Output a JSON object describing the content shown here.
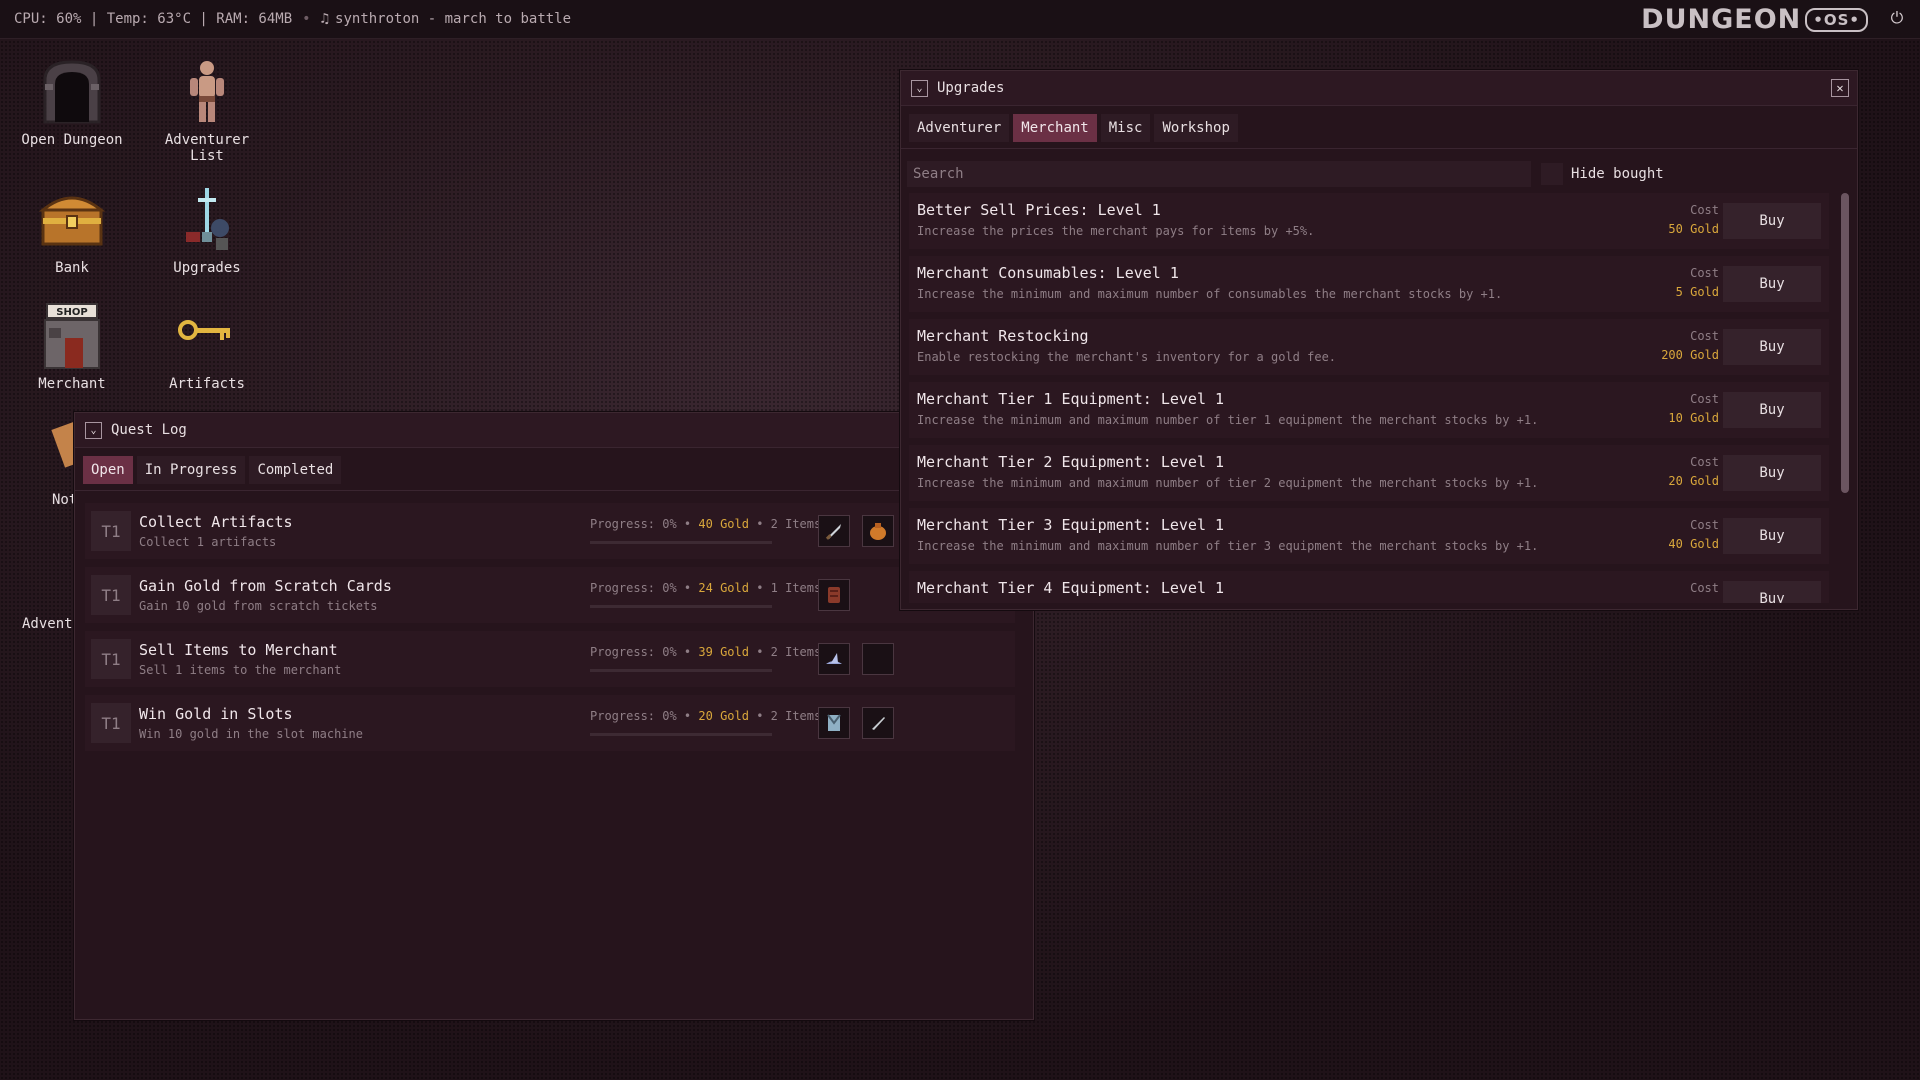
{
  "topbar": {
    "stats": "CPU: 60% | Temp: 63°C | RAM: 64MB",
    "track": "synthroton - march to battle",
    "music_icon": "music-note-icon",
    "logo_text": "DUNGEON",
    "logo_badge": "OS",
    "power_icon": "power-icon"
  },
  "desktop": {
    "icons": [
      {
        "label": "Open Dungeon",
        "icon": "dungeon-door-icon"
      },
      {
        "label": "Adventurer List",
        "icon": "adventurer-figure-icon"
      },
      {
        "label": "Bank",
        "icon": "treasure-chest-icon"
      },
      {
        "label": "Upgrades",
        "icon": "upgrades-icon"
      },
      {
        "label": "Merchant",
        "icon": "shop-icon"
      },
      {
        "label": "Artifacts",
        "icon": "key-icon"
      },
      {
        "label": "Not",
        "icon": "notes-scroll-icon"
      },
      {
        "label": "Adventu",
        "icon": "lightbulb-icon"
      }
    ]
  },
  "quest_log": {
    "title": "Quest Log",
    "tabs": [
      "Open",
      "In Progress",
      "Completed"
    ],
    "active_tab": "Open",
    "quests": [
      {
        "tier": "T1",
        "title": "Collect Artifacts",
        "desc": "Collect 1 artifacts",
        "progress": "Progress: 0%",
        "gold": "40 Gold",
        "items": "2 Items",
        "progress_value": 0
      },
      {
        "tier": "T1",
        "title": "Gain Gold from Scratch Cards",
        "desc": "Gain 10 gold from scratch tickets",
        "progress": "Progress: 0%",
        "gold": "24 Gold",
        "items": "1 Items",
        "progress_value": 0
      },
      {
        "tier": "T1",
        "title": "Sell Items to Merchant",
        "desc": "Sell 1 items to the merchant",
        "progress": "Progress: 0%",
        "gold": "39 Gold",
        "items": "2 Items",
        "progress_value": 0
      },
      {
        "tier": "T1",
        "title": "Win Gold in Slots",
        "desc": "Win 10 gold in the slot machine",
        "progress": "Progress: 0%",
        "gold": "20 Gold",
        "items": "2 Items",
        "progress_value": 0
      }
    ]
  },
  "upgrades": {
    "title": "Upgrades",
    "tabs": [
      "Adventurer",
      "Merchant",
      "Misc",
      "Workshop"
    ],
    "active_tab": "Merchant",
    "search_placeholder": "Search",
    "hide_bought_label": "Hide bought",
    "cost_label": "Cost",
    "buy_label": "Buy",
    "items": [
      {
        "title": "Better Sell Prices: Level 1",
        "desc": "Increase the prices the merchant pays for items by +5%.",
        "cost": "50 Gold"
      },
      {
        "title": "Merchant Consumables: Level 1",
        "desc": "Increase the minimum and maximum number of consumables the merchant stocks by +1.",
        "cost": "5 Gold"
      },
      {
        "title": "Merchant Restocking",
        "desc": "Enable restocking the merchant's inventory for a gold fee.",
        "cost": "200 Gold"
      },
      {
        "title": "Merchant Tier 1 Equipment: Level 1",
        "desc": "Increase the minimum and maximum number of tier 1 equipment the merchant stocks by +1.",
        "cost": "10 Gold"
      },
      {
        "title": "Merchant Tier 2 Equipment: Level 1",
        "desc": "Increase the minimum and maximum number of tier 2 equipment the merchant stocks by +1.",
        "cost": "20 Gold"
      },
      {
        "title": "Merchant Tier 3 Equipment: Level 1",
        "desc": "Increase the minimum and maximum number of tier 3 equipment the merchant stocks by +1.",
        "cost": "40 Gold"
      },
      {
        "title": "Merchant Tier 4 Equipment: Level 1",
        "desc": "",
        "cost": ""
      }
    ]
  }
}
